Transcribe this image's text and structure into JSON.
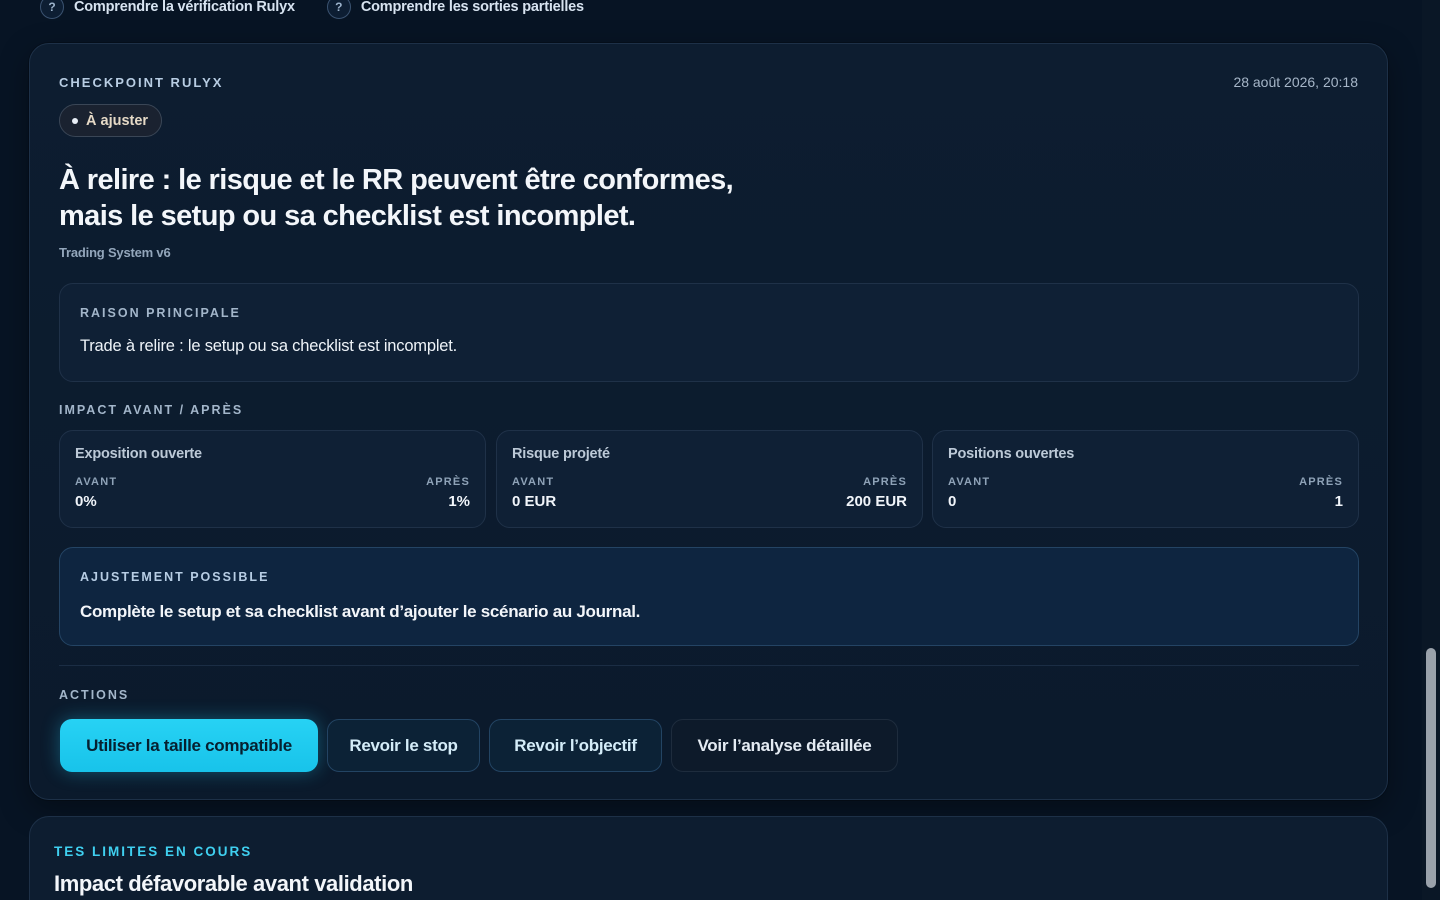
{
  "help_links": [
    {
      "icon": "question-icon",
      "glyph": "?",
      "label": "Comprendre la vérification Rulyx"
    },
    {
      "icon": "question-icon",
      "glyph": "?",
      "label": "Comprendre les sorties partielles"
    }
  ],
  "checkpoint": {
    "eyebrow": "CHECKPOINT RULYX",
    "date": "28 août 2026, 20:18",
    "status_label": "À ajuster",
    "headline_line1": "À relire : le risque et le RR peuvent être conformes,",
    "headline_line2": "mais le setup ou sa checklist est incomplet.",
    "system": "Trading System v6"
  },
  "reason": {
    "title": "RAISON PRINCIPALE",
    "text": "Trade à relire : le setup ou sa checklist est incomplet."
  },
  "impact": {
    "title": "IMPACT AVANT / APRÈS",
    "before_label": "AVANT",
    "after_label": "APRÈS",
    "metrics": [
      {
        "name": "Exposition ouverte",
        "before": "0%",
        "after": "1%"
      },
      {
        "name": "Risque projeté",
        "before": "0 EUR",
        "after": "200 EUR"
      },
      {
        "name": "Positions ouvertes",
        "before": "0",
        "after": "1"
      }
    ]
  },
  "adjustment": {
    "title": "AJUSTEMENT POSSIBLE",
    "text": "Complète le setup et sa checklist avant d’ajouter le scénario au Journal."
  },
  "actions": {
    "title": "ACTIONS",
    "primary": "Utiliser la taille compatible",
    "review_stop": "Revoir le stop",
    "review_target": "Revoir l’objectif",
    "detailed": "Voir l’analyse détaillée"
  },
  "limits": {
    "eyebrow": "TES LIMITES EN COURS",
    "title": "Impact défavorable avant validation"
  },
  "colors": {
    "background": "#071424",
    "card": "#0d1d30",
    "accent": "#27d2f4",
    "accent_text": "#3fd0f0"
  }
}
